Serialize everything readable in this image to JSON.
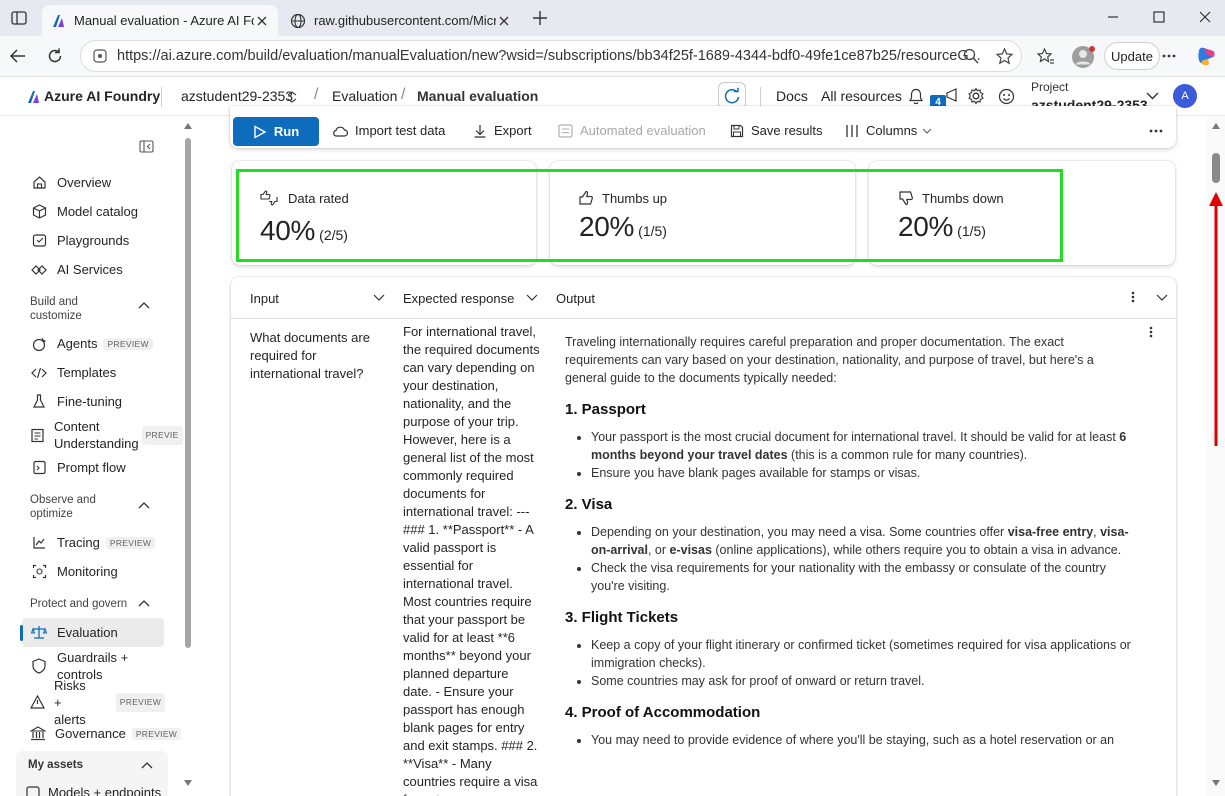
{
  "browser": {
    "tabs": [
      {
        "title": "Manual evaluation - Azure AI Fou",
        "active": true
      },
      {
        "title": "raw.githubusercontent.com/Micro",
        "active": false
      }
    ],
    "url": "https://ai.azure.com/build/evaluation/manualEvaluation/new?wsid=/subscriptions/bb34f25f-1689-4344-bdf0-49fe1ce87b25/resourceG...",
    "update_label": "Update"
  },
  "header": {
    "brand": "Azure AI Foundry",
    "workspace": "azstudent29-2353",
    "breadcrumb": [
      "Evaluation",
      "Manual evaluation"
    ],
    "links": [
      "Docs",
      "All resources"
    ],
    "notification_count": "4",
    "project_label": "Project",
    "project_name": "azstudent29-2353",
    "avatar_initial": "A"
  },
  "sidebar": {
    "items_top": [
      "Overview",
      "Model catalog",
      "Playgrounds",
      "AI Services"
    ],
    "section_build": [
      "Build and",
      "customize"
    ],
    "items_build": [
      "Agents",
      "Templates",
      "Fine-tuning",
      "Content",
      "Understanding",
      "Prompt flow"
    ],
    "section_observe": [
      "Observe and",
      "optimize"
    ],
    "items_observe": [
      "Tracing",
      "Monitoring"
    ],
    "section_protect": "Protect and govern",
    "items_protect": [
      "Evaluation",
      "Guardrails +",
      "controls",
      "Risks +",
      "alerts",
      "Governance"
    ],
    "preview": "PREVIEW",
    "preview_short": "PREVIE",
    "my_assets": "My assets",
    "partial_item": "Models + endpoints"
  },
  "toolbar": {
    "run": "Run",
    "import": "Import test data",
    "export": "Export",
    "automated": "Automated evaluation",
    "save": "Save results",
    "columns": "Columns"
  },
  "stats": [
    {
      "label": "Data rated",
      "value": "40%",
      "fraction": "(2/5)"
    },
    {
      "label": "Thumbs up",
      "value": "20%",
      "fraction": "(1/5)"
    },
    {
      "label": "Thumbs down",
      "value": "20%",
      "fraction": "(1/5)"
    }
  ],
  "table": {
    "columns": [
      "Input",
      "Expected response",
      "Output"
    ],
    "input": "What documents are required for international travel?",
    "expected": "For international travel, the required documents can vary depending on your destination, nationality, and the purpose of your trip. However, here is a general list of the most commonly required documents for international travel: --- ### 1. **Passport** - A valid passport is essential for international travel. Most countries require that your passport be valid for at least **6 months** beyond your planned departure date. - Ensure your passport has enough blank pages for entry and exit stamps. ### 2. **Visa** - Many countries require a visa for entry,",
    "output": {
      "intro": "Traveling internationally requires careful preparation and proper documentation. The exact requirements can vary based on your destination, nationality, and purpose of travel, but here's a general guide to the documents typically needed:",
      "h1": "1. Passport",
      "p1a_1": "Your passport is the most crucial document for international travel. It should be valid for at least ",
      "p1a_b": "6 months beyond your travel dates",
      "p1a_2": " (this is a common rule for many countries).",
      "p1b": "Ensure you have blank pages available for stamps or visas.",
      "h2": "2. Visa",
      "p2a_1": "Depending on your destination, you may need a visa. Some countries offer ",
      "p2a_b1": "visa-free entry",
      "p2a_c": ", ",
      "p2a_b2": "visa-on-arrival",
      "p2a_or": ", or ",
      "p2a_b3": "e-visas",
      "p2a_2": " (online applications), while others require you to obtain a visa in advance.",
      "p2b": "Check the visa requirements for your nationality with the embassy or consulate of the country you're visiting.",
      "h3": "3. Flight Tickets",
      "p3a": "Keep a copy of your flight itinerary or confirmed ticket (sometimes required for visa applications or immigration checks).",
      "p3b": "Some countries may ask for proof of onward or return travel.",
      "h4": "4. Proof of Accommodation",
      "p4a": "You may need to provide evidence of where you'll be staying, such as a hotel reservation or an"
    }
  },
  "colors": {
    "accent": "#0f6cbd",
    "highlight": "#22dd22",
    "arrow": "#e00000"
  }
}
